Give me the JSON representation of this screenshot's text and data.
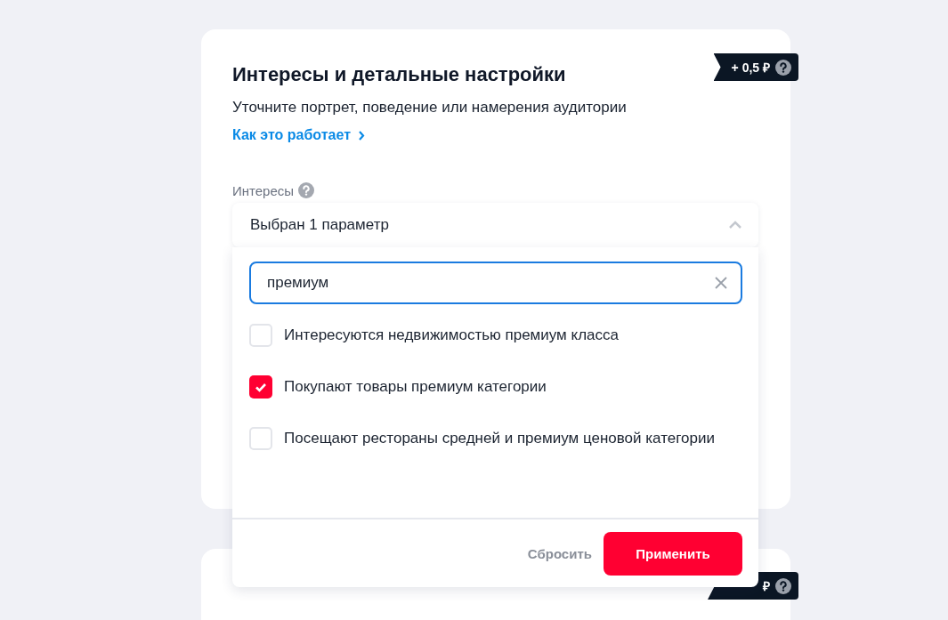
{
  "card": {
    "title": "Интересы и детальные настройки",
    "subtitle": "Уточните портрет, поведение или намерения аудитории",
    "link": "Как это работает",
    "badge": "+ 0,5 ₽",
    "field_label": "Интересы",
    "select": {
      "value": "Выбран 1 параметр",
      "expanded": true
    },
    "dropdown": {
      "search": {
        "value": "премиум"
      },
      "options": [
        {
          "label": "Интересуются недвижимостью премиум класса",
          "checked": false
        },
        {
          "label": "Покупают товары премиум категории",
          "checked": true
        },
        {
          "label": "Посещают рестораны средней и премиум ценовой категории",
          "checked": false
        }
      ],
      "reset": "Сбросить",
      "apply": "Применить"
    }
  },
  "card_2": {
    "badge": "₽"
  }
}
